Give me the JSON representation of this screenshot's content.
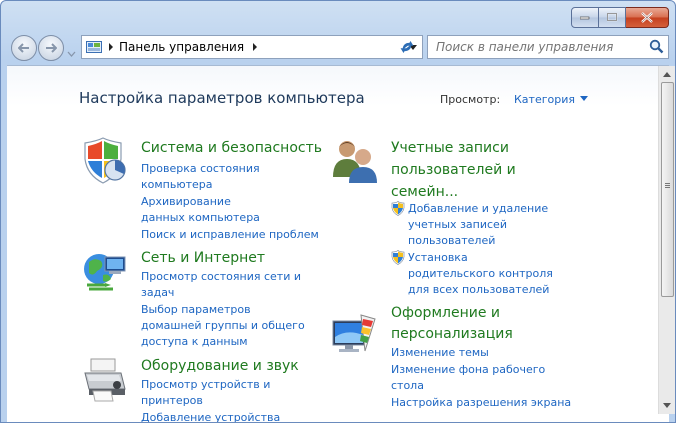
{
  "window": {
    "address_path": "Панель управления",
    "search_placeholder": "Поиск в панели управления"
  },
  "header": {
    "title": "Настройка параметров компьютера",
    "view_label": "Просмотр:",
    "view_value": "Категория"
  },
  "categories": [
    {
      "title": "Система и безопасность",
      "icon": "shield-system-icon",
      "links": [
        "Проверка состояния компьютера",
        "Архивирование данных компьютера",
        "Поиск и исправление проблем"
      ]
    },
    {
      "title": "Сеть и Интернет",
      "icon": "network-globe-icon",
      "links": [
        "Просмотр состояния сети и задач",
        "Выбор параметров домашней группы и общего доступа к данным"
      ]
    },
    {
      "title": "Оборудование и звук",
      "icon": "printer-hardware-icon",
      "links": [
        "Просмотр устройств и принтеров",
        "Добавление устройства"
      ]
    },
    {
      "title": "Учетные записи пользователей и семейн...",
      "icon": "users-icon",
      "links": [
        "Добавление и удаление учетных записей пользователей",
        "Установка родительского контроля для всех пользователей"
      ]
    },
    {
      "title": "Оформление и персонализация",
      "icon": "personalization-monitor-icon",
      "links": [
        "Изменение темы",
        "Изменение фона рабочего стола",
        "Настройка разрешения экрана"
      ]
    }
  ],
  "colors": {
    "category_title": "#1f7a1f",
    "link": "#1e66c2",
    "page_title": "#1e395b"
  }
}
